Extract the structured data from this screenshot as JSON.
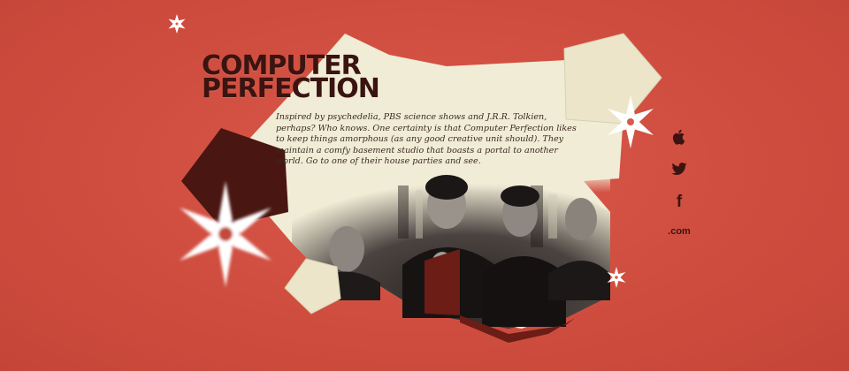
{
  "logo": {
    "line1": "COMPUTER",
    "line2": "PERFECTION"
  },
  "blurb": "Inspired by psychedelia, PBS science shows and J.R.R. Tolkien, perhaps? Who knows. One certainty is that Computer Perfection likes to keep things amorphous (as any good creative unit should). They maintain a comfy basement studio that boasts a portal to another world. Go to one of their house parties and see.",
  "social": {
    "facebook_glyph": "f",
    "website_label": ".com"
  },
  "colors": {
    "background": "#cf4d3f",
    "paper": "#f1ecd6",
    "dark": "#3a1410",
    "snowflake": "#ffffff"
  },
  "icons": [
    "snowflake-icon",
    "apple-icon",
    "twitter-bird-icon",
    "facebook-icon"
  ]
}
